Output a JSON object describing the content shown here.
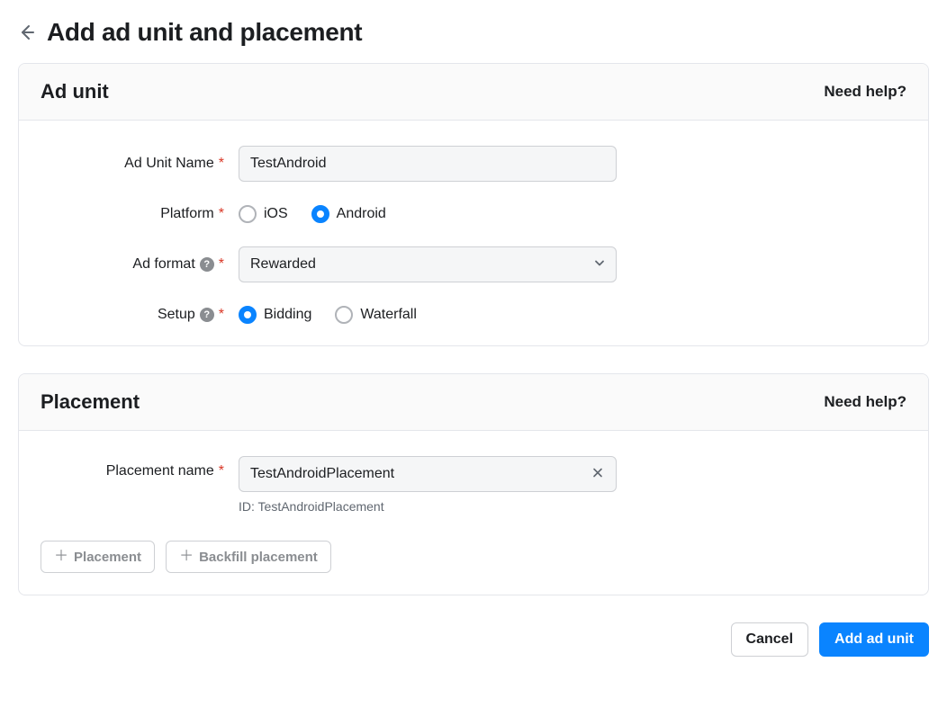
{
  "page": {
    "title": "Add ad unit and placement"
  },
  "ad_unit_section": {
    "title": "Ad unit",
    "help_link": "Need help?",
    "fields": {
      "name": {
        "label": "Ad Unit Name",
        "value": "TestAndroid"
      },
      "platform": {
        "label": "Platform",
        "options": {
          "ios": "iOS",
          "android": "Android"
        },
        "selected": "android"
      },
      "format": {
        "label": "Ad format",
        "value": "Rewarded"
      },
      "setup": {
        "label": "Setup",
        "options": {
          "bidding": "Bidding",
          "waterfall": "Waterfall"
        },
        "selected": "bidding"
      }
    }
  },
  "placement_section": {
    "title": "Placement",
    "help_link": "Need help?",
    "fields": {
      "name": {
        "label": "Placement name",
        "value": "TestAndroidPlacement",
        "id_hint": "ID: TestAndroidPlacement"
      }
    },
    "actions": {
      "add_placement": "Placement",
      "add_backfill": "Backfill placement"
    }
  },
  "footer": {
    "cancel": "Cancel",
    "submit": "Add ad unit"
  }
}
